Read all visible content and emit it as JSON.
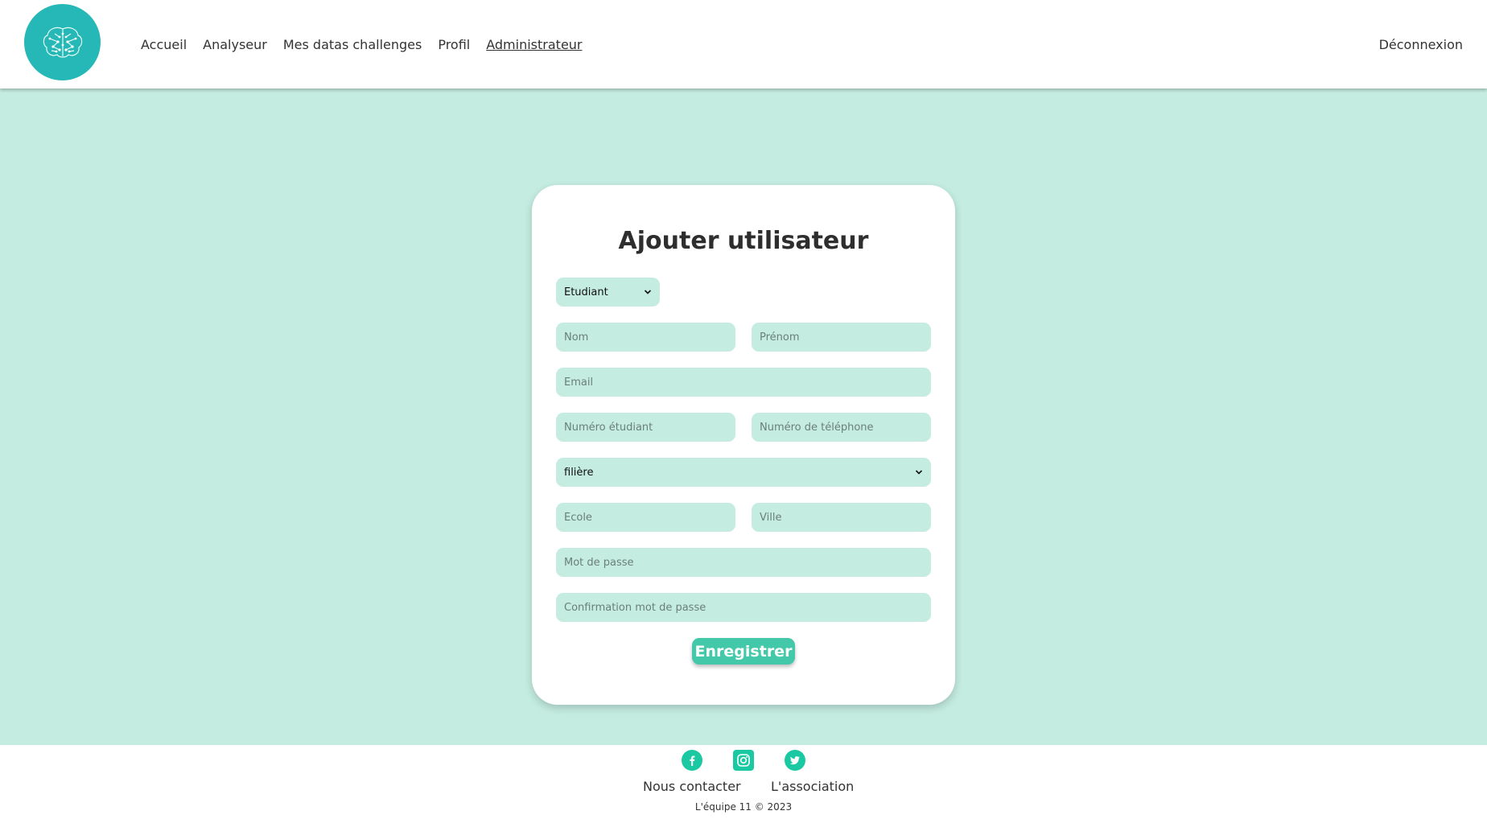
{
  "header": {
    "logo_icon": "brain-icon",
    "nav": [
      {
        "label": "Accueil"
      },
      {
        "label": "Analyseur"
      },
      {
        "label": "Mes datas challenges"
      },
      {
        "label": "Profil"
      },
      {
        "label": "Administrateur",
        "active": true
      }
    ],
    "logout_label": "Déconnexion"
  },
  "form": {
    "title": "Ajouter utilisateur",
    "role_select": "Etudiant",
    "nom_placeholder": "Nom",
    "prenom_placeholder": "Prénom",
    "email_placeholder": "Email",
    "numero_etudiant_placeholder": "Numéro étudiant",
    "telephone_placeholder": "Numéro de téléphone",
    "filiere_select": "filière",
    "ecole_placeholder": "École",
    "ville_placeholder": "Ville",
    "password_placeholder": "Mot de passe",
    "password_confirm_placeholder": "Confirmation mot de passe",
    "submit_label": "Enregistrer"
  },
  "footer": {
    "social_icons": [
      "facebook-icon",
      "instagram-icon",
      "twitter-icon"
    ],
    "contact_label": "Nous contacter",
    "association_label": "L'association",
    "copyright": "L'équipe 11 © 2023"
  },
  "colors": {
    "background": "#c4ece1",
    "accent": "#43c9a9",
    "logo": "#26b8b6",
    "field": "#c4ece1"
  }
}
